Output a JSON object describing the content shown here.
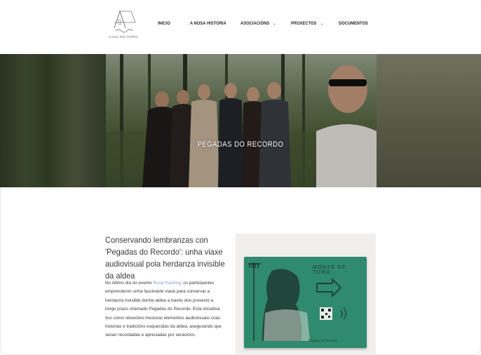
{
  "logo": {
    "caption": "CASA DO FORO"
  },
  "nav": {
    "items": [
      {
        "label": "INICIO",
        "has_dropdown": false
      },
      {
        "label": "A NOSA HISTORIA",
        "has_dropdown": false
      },
      {
        "label": "ASOCIACIÓNS",
        "has_dropdown": true
      },
      {
        "label": "PROXECTOS",
        "has_dropdown": true
      },
      {
        "label": "DOCUMENTOS",
        "has_dropdown": false
      }
    ],
    "chevron": "⌄"
  },
  "hero": {
    "title": "PEGADAS DO RECORDO"
  },
  "article": {
    "title": "Conservando lembranzas con 'Pegadas do Recordo': unha viaxe audiovisual pola herdanza invisible da aldea",
    "body_pre": "No último día do evento ",
    "body_link": "Rural Hacking",
    "body_post": ", os participantes emprenderon unha fascinante viaxe para conservar a herdanza invisible dunha aldea a través dun proxecto a longo prazo chamado Pegadas do Recordo. Esta iniciativa tivo como obxectivo mesturar elementos audiovisuais coas historias e tradicións esquecidas da aldea, asegurando que sexan recordadas e apreciadas por xeracións."
  },
  "card": {
    "title": "MONTE DE TORO",
    "subtitle": "Pegadas do Recordo"
  },
  "colors": {
    "card_green": "#2f8a6e",
    "link": "#8aa0c0",
    "text": "#3a3a3a"
  }
}
